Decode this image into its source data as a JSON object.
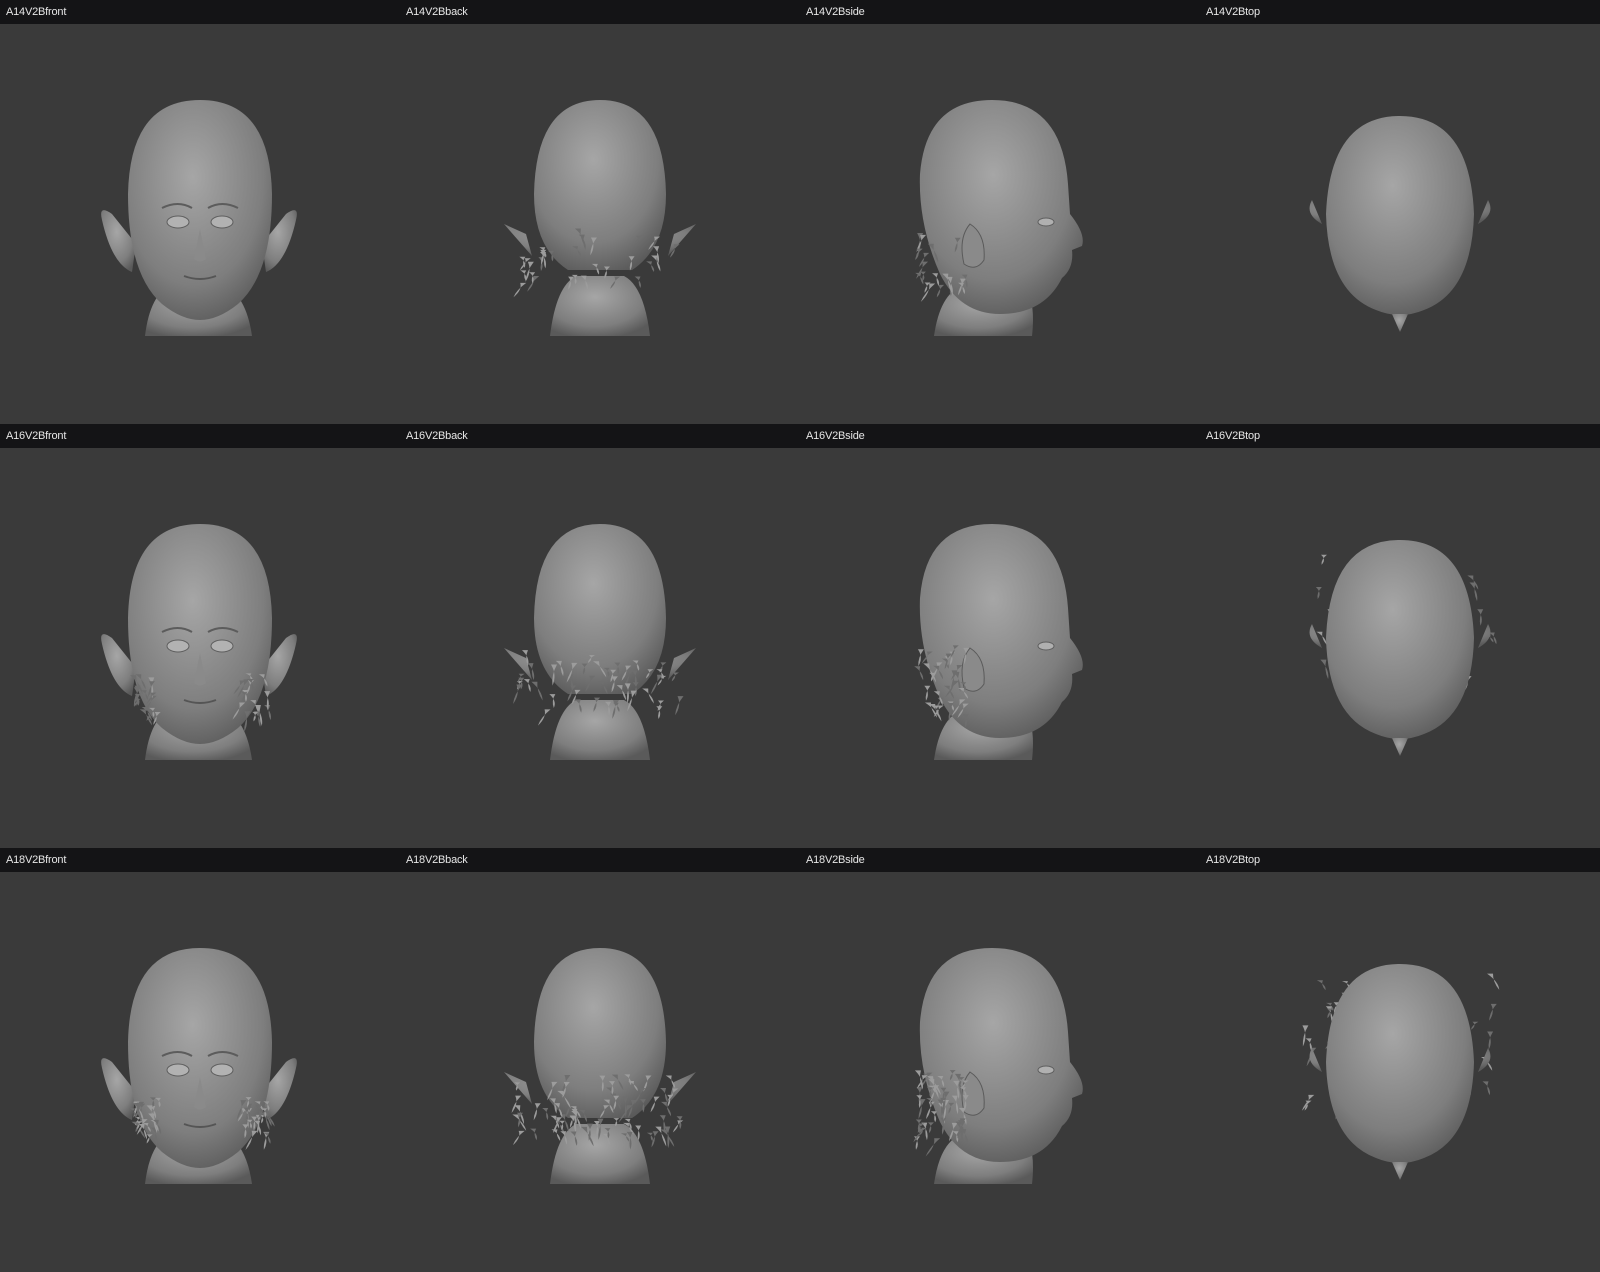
{
  "viewports": [
    {
      "label": "A14V2Bfront",
      "view": "front",
      "hair": "low"
    },
    {
      "label": "A14V2Bback",
      "view": "back",
      "hair": "low"
    },
    {
      "label": "A14V2Bside",
      "view": "side",
      "hair": "low"
    },
    {
      "label": "A14V2Btop",
      "view": "top",
      "hair": "low"
    },
    {
      "label": "A16V2Bfront",
      "view": "front",
      "hair": "mid"
    },
    {
      "label": "A16V2Bback",
      "view": "back",
      "hair": "mid"
    },
    {
      "label": "A16V2Bside",
      "view": "side",
      "hair": "mid"
    },
    {
      "label": "A16V2Btop",
      "view": "top",
      "hair": "mid"
    },
    {
      "label": "A18V2Bfront",
      "view": "front",
      "hair": "high"
    },
    {
      "label": "A18V2Bback",
      "view": "back",
      "hair": "high"
    },
    {
      "label": "A18V2Bside",
      "view": "side",
      "hair": "high"
    },
    {
      "label": "A18V2Btop",
      "view": "top",
      "hair": "high"
    }
  ],
  "colors": {
    "background": "#3a3a3a",
    "header": "#141416",
    "header_text": "#e6e6e6",
    "mesh_light": "#9a9a9a",
    "mesh_mid": "#7e7e7e",
    "mesh_dark": "#5a5a5a"
  }
}
